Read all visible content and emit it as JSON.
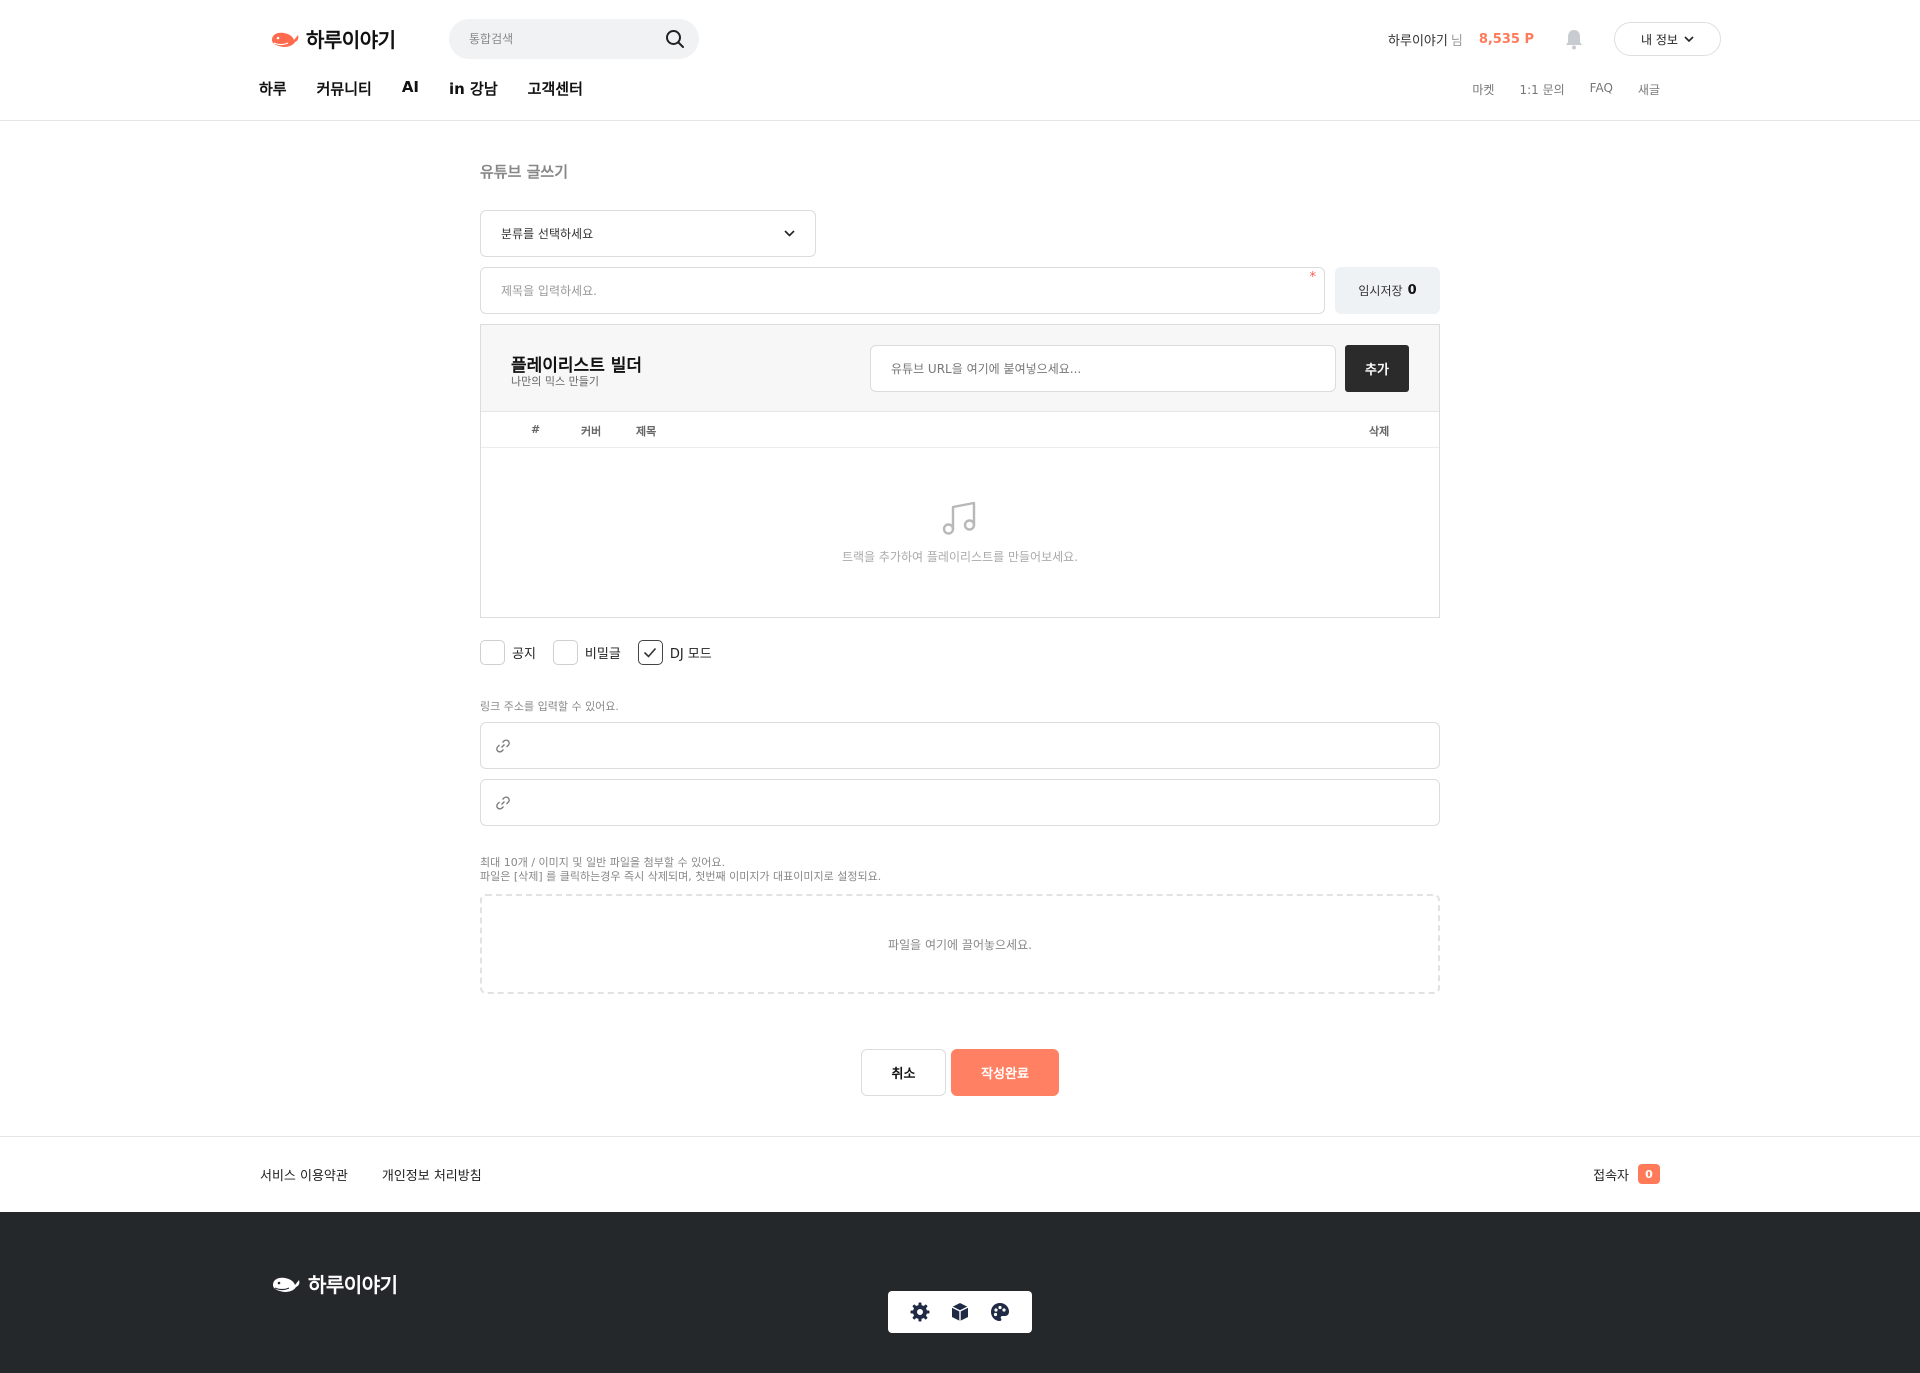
{
  "header": {
    "logo_text": "하루이야기",
    "search_placeholder": "통합검색",
    "user_name": "하루이야기",
    "user_suffix": "님",
    "points": "8,535 P",
    "my_info_label": "내 정보",
    "nav": [
      "하루",
      "커뮤니티",
      "AI",
      "in 강남",
      "고객센터"
    ],
    "util": [
      "마켓",
      "1:1 문의",
      "FAQ",
      "새글"
    ]
  },
  "form": {
    "page_title": "유튜브 글쓰기",
    "category_placeholder": "분류를 선택하세요",
    "title_placeholder": "제목을 입력하세요.",
    "required_mark": "*",
    "temp_save_label": "임시저장",
    "temp_save_count": "0",
    "playlist": {
      "title": "플레이리스트 빌더",
      "subtitle": "나만의 믹스 만들기",
      "url_placeholder": "유튜브 URL을 여기에 붙여넣으세요...",
      "add_label": "추가",
      "columns": {
        "num": "#",
        "cover": "커버",
        "title": "제목",
        "delete": "삭제"
      },
      "empty_text": "트랙을 추가하여 플레이리스트를 만들어보세요."
    },
    "options": [
      {
        "label": "공지",
        "checked": false
      },
      {
        "label": "비밀글",
        "checked": false
      },
      {
        "label": "DJ 모드",
        "checked": true
      }
    ],
    "link_help": "링크 주소를 입력할 수 있어요.",
    "file_help_1": "최대 10개 / 이미지 및 일반 파일을 첨부할 수 있어요.",
    "file_help_2": "파일은 [삭제] 를 클릭하는경우 즉시 삭제되며, 첫번째 이미지가 대표이미지로 설정되요.",
    "dropzone_text": "파일을 여기에 끌어놓으세요.",
    "cancel_label": "취소",
    "submit_label": "작성완료"
  },
  "footer": {
    "links": [
      "서비스 이용약관",
      "개인정보 처리방침"
    ],
    "visitor_label": "접속자",
    "visitor_count": "0",
    "logo_text": "하루이야기",
    "tools": [
      "gear-icon",
      "cube-icon",
      "palette-icon"
    ]
  },
  "colors": {
    "accent": "#ff7a59",
    "submit": "#ff8062",
    "dark": "#25282b",
    "add_button": "#2b2b2b"
  }
}
